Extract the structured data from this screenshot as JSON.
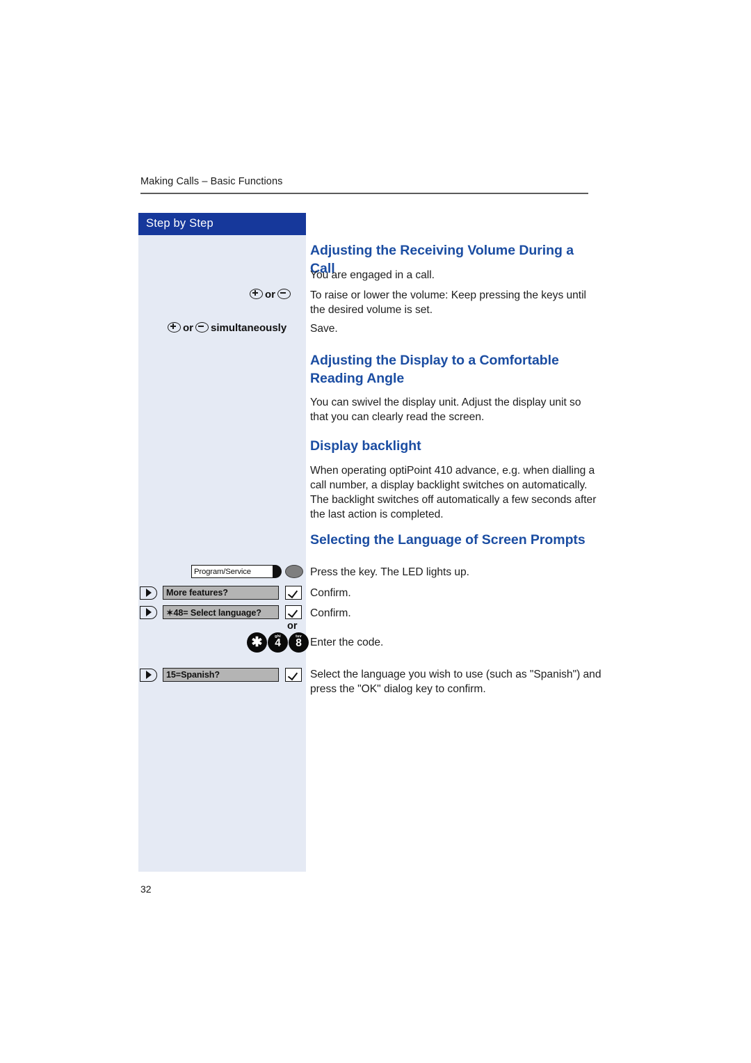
{
  "document": {
    "running_header": "Making Calls – Basic Functions",
    "page_number": "32"
  },
  "sidebar": {
    "title": "Step by Step",
    "volume_keys_label_1": {
      "plus_icon": "plus-circle-icon",
      "or": "or",
      "minus_icon": "minus-circle-icon"
    },
    "volume_keys_label_2": {
      "plus_icon": "plus-circle-icon",
      "or": "or",
      "minus_icon": "minus-circle-icon",
      "suffix": "simultaneously"
    },
    "program_service_key": {
      "label": "Program/Service",
      "led_name": "key-led-indicator"
    },
    "dialog_rows": [
      {
        "name": "more-features",
        "text": "More features?",
        "ok_icon": "checkmark-icon",
        "arrow_icon": "dialog-arrow-icon"
      },
      {
        "name": "select-language",
        "text": "✶48= Select language?",
        "ok_icon": "checkmark-icon",
        "arrow_icon": "dialog-arrow-icon"
      },
      {
        "name": "spanish",
        "text": "15=Spanish?",
        "ok_icon": "checkmark-icon",
        "arrow_icon": "dialog-arrow-icon"
      }
    ],
    "or_separator": "or",
    "keypad": [
      {
        "num": "✱",
        "letters": ""
      },
      {
        "num": "4",
        "letters": "ghi"
      },
      {
        "num": "8",
        "letters": "tuv"
      }
    ]
  },
  "content": {
    "section_1": {
      "heading": "Adjusting the Receiving Volume During a Call",
      "para_1": "You are engaged in a call.",
      "para_2": "To raise or lower the volume: Keep pressing the keys until the desired volume is set.",
      "para_3": "Save."
    },
    "section_2": {
      "heading": "Adjusting the Display to a Comfortable Reading Angle",
      "para_1": "You can swivel the display unit. Adjust the display unit so that you can clearly read the screen."
    },
    "section_3": {
      "heading": "Display backlight",
      "para_1": "When operating optiPoint 410 advance, e.g. when dialling a call number, a display backlight switches on automatically. The backlight switches off automatically a few seconds after the last action is completed."
    },
    "section_4": {
      "heading": "Selecting the Language of Screen Prompts",
      "para_1": "Press the key. The LED lights up.",
      "para_2": "Confirm.",
      "para_3": "Confirm.",
      "para_4": "Enter the code.",
      "para_5": "Select the language you wish to use (such as \"Spanish\") and press the \"OK\" dialog key to confirm."
    }
  },
  "colors": {
    "header_blue": "#16389b",
    "heading_blue": "#1b4da2",
    "sidebar_bg": "#e5eaf4"
  }
}
